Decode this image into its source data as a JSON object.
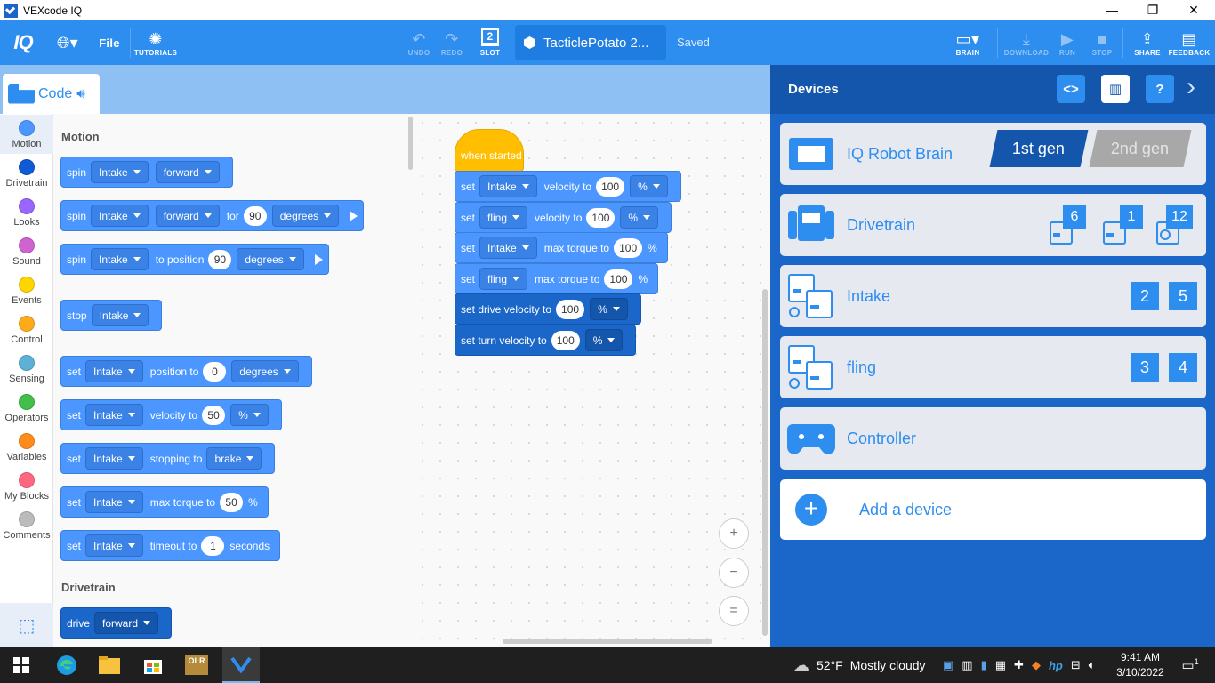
{
  "window": {
    "title": "VEXcode IQ",
    "minimize": "—",
    "restore": "❐",
    "close": "✕"
  },
  "toolbar": {
    "logo": "IQ",
    "file_label": "File",
    "tutorials_label": "TUTORIALS",
    "undo_label": "UNDO",
    "redo_label": "REDO",
    "slot_label": "SLOT",
    "slot_number": "2",
    "project_name": "TacticlePotato 2...",
    "save_status": "Saved",
    "brain_label": "BRAIN",
    "download_label": "DOWNLOAD",
    "run_label": "RUN",
    "stop_label": "STOP",
    "share_label": "SHARE",
    "feedback_label": "FEEDBACK"
  },
  "code_tab": {
    "label": "Code"
  },
  "categories": [
    {
      "label": "Motion",
      "color": "#4c97ff"
    },
    {
      "label": "Drivetrain",
      "color": "#0f5bd6"
    },
    {
      "label": "Looks",
      "color": "#9966ff"
    },
    {
      "label": "Sound",
      "color": "#cf63cf"
    },
    {
      "label": "Events",
      "color": "#ffd500"
    },
    {
      "label": "Control",
      "color": "#ffab19"
    },
    {
      "label": "Sensing",
      "color": "#5cb1d6"
    },
    {
      "label": "Operators",
      "color": "#40bf4a"
    },
    {
      "label": "Variables",
      "color": "#ff8c1a"
    },
    {
      "label": "My Blocks",
      "color": "#ff6680"
    },
    {
      "label": "Comments",
      "color": "#bbbbbb"
    }
  ],
  "palette": {
    "motion_header": "Motion",
    "drivetrain_header": "Drivetrain",
    "b1": {
      "w1": "spin",
      "d1": "Intake",
      "d2": "forward"
    },
    "b2": {
      "w1": "spin",
      "d1": "Intake",
      "d2": "forward",
      "w2": "for",
      "n1": "90",
      "d3": "degrees"
    },
    "b3": {
      "w1": "spin",
      "d1": "Intake",
      "w2": "to position",
      "n1": "90",
      "d3": "degrees"
    },
    "b4": {
      "w1": "stop",
      "d1": "Intake"
    },
    "b5": {
      "w1": "set",
      "d1": "Intake",
      "w2": "position to",
      "n1": "0",
      "d3": "degrees"
    },
    "b6": {
      "w1": "set",
      "d1": "Intake",
      "w2": "velocity to",
      "n1": "50",
      "d3": "%"
    },
    "b7": {
      "w1": "set",
      "d1": "Intake",
      "w2": "stopping to",
      "d3": "brake"
    },
    "b8": {
      "w1": "set",
      "d1": "Intake",
      "w2": "max torque to",
      "n1": "50",
      "w3": "%"
    },
    "b9": {
      "w1": "set",
      "d1": "Intake",
      "w2": "timeout to",
      "n1": "1",
      "w3": "seconds"
    },
    "b10": {
      "w1": "drive",
      "d1": "forward"
    }
  },
  "script": {
    "hat": "when started",
    "s1": {
      "w1": "set",
      "d1": "Intake",
      "w2": "velocity to",
      "n1": "100",
      "d3": "%"
    },
    "s2": {
      "w1": "set",
      "d1": "fling",
      "w2": "velocity to",
      "n1": "100",
      "d3": "%"
    },
    "s3": {
      "w1": "set",
      "d1": "Intake",
      "w2": "max torque to",
      "n1": "100",
      "w3": "%"
    },
    "s4": {
      "w1": "set",
      "d1": "fling",
      "w2": "max torque to",
      "n1": "100",
      "w3": "%"
    },
    "s5": {
      "w1": "set drive velocity to",
      "n1": "100",
      "d3": "%"
    },
    "s6": {
      "w1": "set turn velocity to",
      "n1": "100",
      "d3": "%"
    }
  },
  "zoom": {
    "in": "+",
    "out": "−",
    "reset": "="
  },
  "devices": {
    "title": "Devices",
    "brain": {
      "name": "IQ Robot Brain",
      "gen1": "1st gen",
      "gen2": "2nd gen"
    },
    "drivetrain": {
      "name": "Drivetrain",
      "ports": [
        "6",
        "1",
        "12"
      ]
    },
    "intake": {
      "name": "Intake",
      "ports": [
        "2",
        "5"
      ]
    },
    "fling": {
      "name": "fling",
      "ports": [
        "3",
        "4"
      ]
    },
    "controller": {
      "name": "Controller"
    },
    "add": {
      "label": "Add a device",
      "icon": "+"
    }
  },
  "taskbar": {
    "weather_temp": "52°F",
    "weather_text": "Mostly cloudy",
    "time": "9:41 AM",
    "date": "3/10/2022",
    "notif_count": "1",
    "olr_label": "OLR"
  }
}
